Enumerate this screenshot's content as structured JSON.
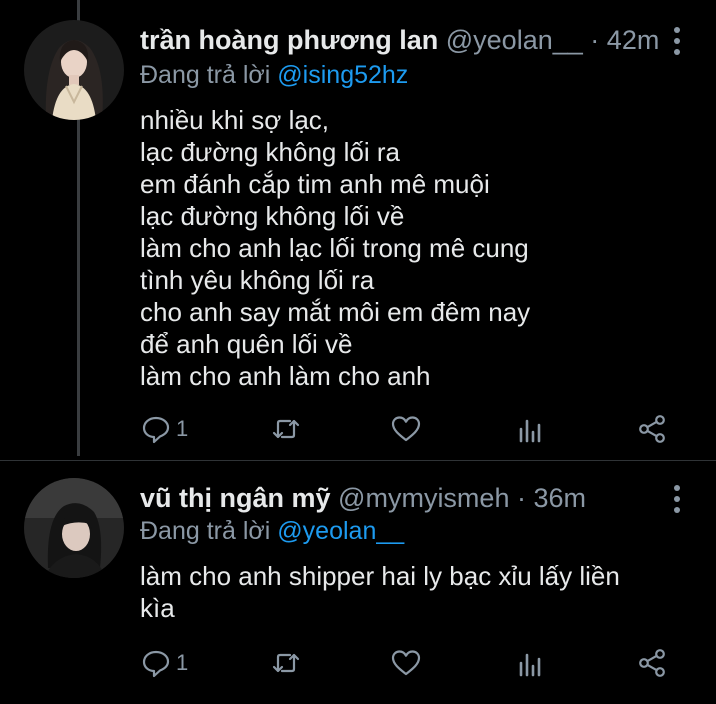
{
  "tweets": [
    {
      "display_name": "trần hoàng phương lan",
      "handle": "@yeolan__",
      "separator": "·",
      "time": "42m",
      "reply_prefix": "Đang trả lời",
      "reply_to": "@ising52hz",
      "text_lines": [
        "nhiều khi sợ lạc,",
        "lạc đường không lối ra",
        "em đánh cắp tim anh mê muội",
        "lạc đường không lối về",
        "làm cho anh lạc lối trong mê cung",
        "tình yêu không lối ra",
        "cho anh say mắt môi em đêm nay",
        "để anh quên lối về",
        "làm cho anh làm cho anh"
      ],
      "reply_count": "1",
      "retweet_count": "",
      "like_count": ""
    },
    {
      "display_name": "vũ thị ngân mỹ",
      "handle": "@mymyismeh",
      "separator": "·",
      "time": "36m",
      "reply_prefix": "Đang trả lời",
      "reply_to": "@yeolan__",
      "text_lines": [
        "làm cho anh shipper hai ly bạc xỉu lấy liền",
        "kìa"
      ],
      "reply_count": "1",
      "retweet_count": "",
      "like_count": ""
    }
  ],
  "icons": {
    "reply": "reply-icon",
    "retweet": "retweet-icon",
    "like": "heart-icon",
    "stats": "analytics-icon",
    "share": "share-icon",
    "more": "more-vertical-icon"
  },
  "colors": {
    "background": "#000000",
    "text": "#e7e9ea",
    "secondary": "#8b98a5",
    "link": "#1d9bf0",
    "thread_line": "#3a3d40"
  }
}
